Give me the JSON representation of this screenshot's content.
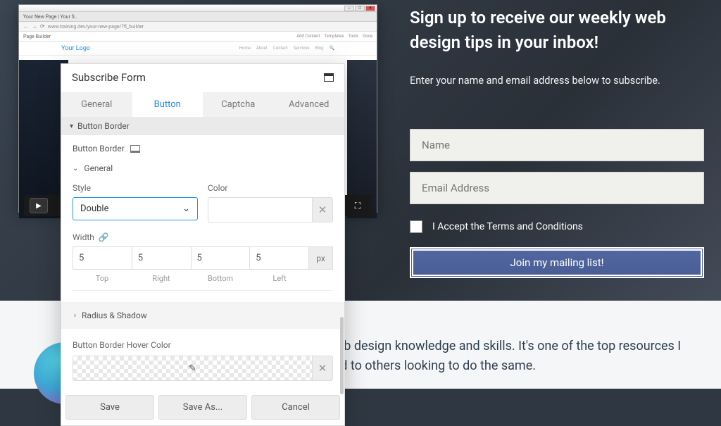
{
  "marketing": {
    "heading": "Sign up to receive our weekly web design tips in your inbox!",
    "subtext": "Enter your name and email address below to subscribe.",
    "name_placeholder": "Name",
    "email_placeholder": "Email Address",
    "consent_text": "I Accept the Terms and Conditions",
    "cta": "Join my mailing list!"
  },
  "testimonial": "go to when it comes to honing my web design knowledge and skills. It's one of the top resources I recommend to others looking to do the same.",
  "browser": {
    "tab_title": "Your New Page | Your S…",
    "url": "www.training.dev/your-new-page/?fl_builder",
    "page_builder": "Page Builder",
    "top_actions": [
      "Add Content",
      "Templates",
      "Tools",
      "Done"
    ],
    "logo": "Your Logo",
    "nav": [
      "Home",
      "About",
      "Contact",
      "Services",
      "Blog"
    ]
  },
  "panel": {
    "title": "Subscribe Form",
    "tabs": [
      "General",
      "Button",
      "Captcha",
      "Advanced"
    ],
    "active_tab": "Button",
    "section_title": "Button Border",
    "border_label": "Button Border",
    "general_label": "General",
    "style_label": "Style",
    "style_value": "Double",
    "color_label": "Color",
    "width_label": "Width",
    "width_values": {
      "top": "5",
      "right": "5",
      "bottom": "5",
      "left": "5"
    },
    "width_sides": [
      "Top",
      "Right",
      "Bottom",
      "Left"
    ],
    "unit": "px",
    "radius_label": "Radius & Shadow",
    "hover_label": "Button Border Hover Color",
    "footer": {
      "save": "Save",
      "save_as": "Save As...",
      "cancel": "Cancel"
    }
  }
}
